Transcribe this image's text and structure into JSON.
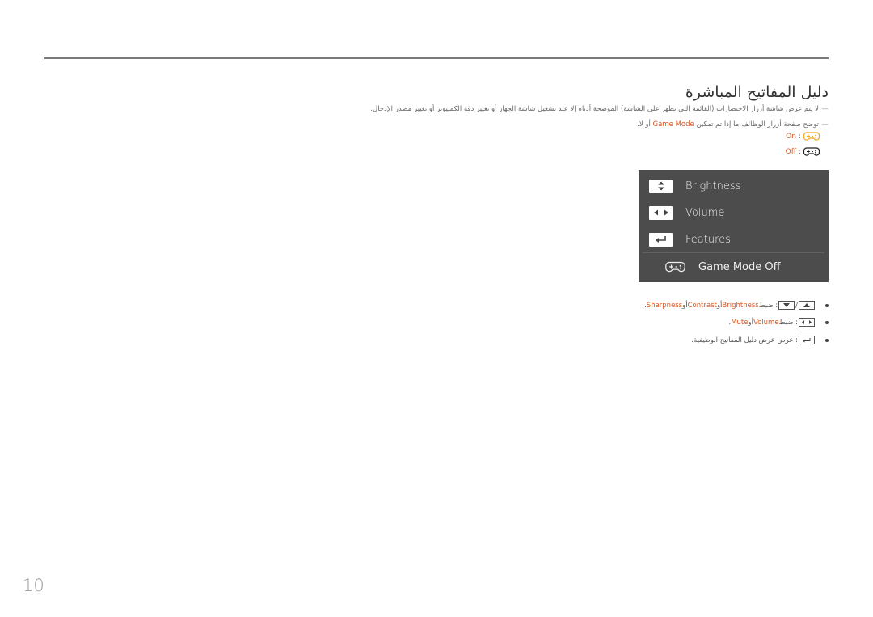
{
  "page": {
    "title": "دليل المفاتيح المباشرة",
    "page_number": "10"
  },
  "notes": [
    {
      "dash": "—",
      "text": "لا يتم عرض شاشة أزرار الاختصارات (القائمة التي تظهر على الشاشة) الموضحة أدناه إلا عند تشغيل شاشة الجهاز أو تغيير دقة الكمبيوتر أو تغيير مصدر الإدخال."
    },
    {
      "dash": "—",
      "text_before": "توضح صفحة أزرار الوظائف ما إذا تم تمكين ",
      "highlight": "Game Mode",
      "text_after": " أو لا."
    }
  ],
  "game_mode_states": [
    {
      "label": "On",
      "separator": " : ",
      "icon": "gamepad-icon",
      "color": "#f5a623"
    },
    {
      "label": "Off",
      "separator": " : ",
      "icon": "gamepad-icon",
      "color": "#222222"
    }
  ],
  "osd": {
    "background": "#4c4c4c",
    "items": [
      {
        "icon": "up-down-arrows-icon",
        "label": "Brightness"
      },
      {
        "icon": "left-right-arrows-icon",
        "label": "Volume"
      },
      {
        "icon": "enter-icon",
        "label": "Features"
      }
    ],
    "game_mode": {
      "icon": "gamepad-icon",
      "label": "Game Mode Off"
    }
  },
  "bullets": [
    {
      "keys": [
        "up-arrow-icon",
        "down-arrow-icon"
      ],
      "prefix": ": ضبط ",
      "items": [
        "Brightness",
        "Contrast",
        "Sharpness"
      ],
      "joiners": [
        " أو ",
        " أو "
      ],
      "end": "."
    },
    {
      "keys": [
        "left-right-arrows-icon"
      ],
      "prefix": ": ضبط ",
      "items": [
        "Volume",
        "Mute"
      ],
      "joiners": [
        " أو "
      ],
      "end": "."
    },
    {
      "keys": [
        "enter-icon"
      ],
      "text": ": عرض عرض دليل المفاتيح الوظيفية."
    }
  ],
  "colors": {
    "accent": "#d9531e",
    "on_icon": "#f5a623",
    "rule": "#7a7a7a"
  }
}
